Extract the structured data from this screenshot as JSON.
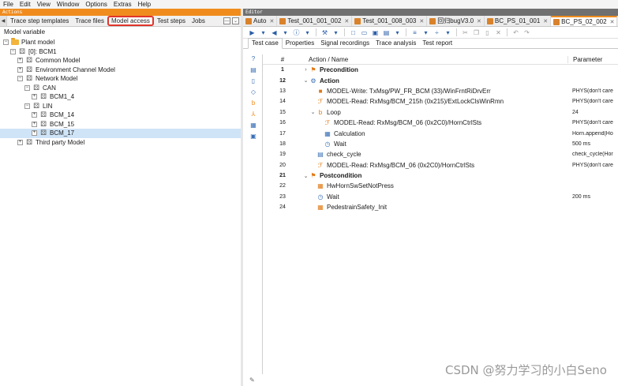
{
  "menu": [
    "File",
    "Edit",
    "View",
    "Window",
    "Options",
    "Extras",
    "Help"
  ],
  "left_panel": {
    "title": "Actions",
    "tabs": [
      "Trace step templates",
      "Trace files",
      "Model access",
      "Test steps",
      "Jobs"
    ],
    "active_tab": "Model access",
    "section_label": "Model variable",
    "tree": [
      {
        "label": "Plant model",
        "indent": 0,
        "expander": "−",
        "icon": "folder-icon"
      },
      {
        "label": "[0]: BCM1",
        "indent": 1,
        "expander": "−",
        "icon": "model-icon"
      },
      {
        "label": "Common Model",
        "indent": 2,
        "expander": "+",
        "icon": "model-icon"
      },
      {
        "label": "Environment Channel Model",
        "indent": 2,
        "expander": "+",
        "icon": "model-icon"
      },
      {
        "label": "Network Model",
        "indent": 2,
        "expander": "−",
        "icon": "model-icon"
      },
      {
        "label": "CAN",
        "indent": 3,
        "expander": "−",
        "icon": "model-icon"
      },
      {
        "label": "BCM1_4",
        "indent": 4,
        "expander": "+",
        "icon": "model-icon"
      },
      {
        "label": "LIN",
        "indent": 3,
        "expander": "−",
        "icon": "model-icon"
      },
      {
        "label": "BCM_14",
        "indent": 4,
        "expander": "+",
        "icon": "model-icon"
      },
      {
        "label": "BCM_15",
        "indent": 4,
        "expander": "+",
        "icon": "model-icon"
      },
      {
        "label": "BCM_17",
        "indent": 4,
        "expander": "+",
        "icon": "model-icon",
        "selected": true
      },
      {
        "label": "Third party Model",
        "indent": 2,
        "expander": "+",
        "icon": "model-icon"
      }
    ]
  },
  "editor": {
    "title": "Editor",
    "tabs": [
      {
        "label": "Auto",
        "active": false
      },
      {
        "label": "Test_001_001_002",
        "active": false
      },
      {
        "label": "Test_001_008_003",
        "active": false
      },
      {
        "label": "回归bugV3.0",
        "active": false
      },
      {
        "label": "BC_PS_01_001",
        "active": false
      },
      {
        "label": "BC_PS_02_002",
        "active": true
      }
    ],
    "sub_tabs": [
      "Test case",
      "Properties",
      "Signal recordings",
      "Trace analysis",
      "Test report"
    ],
    "active_sub_tab": "Test case",
    "columns": {
      "num": "#",
      "action": "Action / Name",
      "param": "Parameter"
    },
    "rows": [
      {
        "num": "1",
        "caret": "›",
        "indent": 0,
        "icon": "precondition-icon",
        "glyph": "⚑",
        "cls": "ri-orange",
        "name": "Precondition",
        "bold": true,
        "param": ""
      },
      {
        "num": "12",
        "caret": "⌄",
        "indent": 0,
        "icon": "action-icon",
        "glyph": "⚙",
        "cls": "ri-blue",
        "name": "Action",
        "bold": true,
        "param": ""
      },
      {
        "num": "13",
        "caret": "",
        "indent": 1,
        "icon": "model-write-icon",
        "glyph": "■",
        "cls": "ri-orange",
        "name": "MODEL-Write: TxMsg/PW_FR_BCM (33)/WinFrntRiDrvErr",
        "bold": false,
        "param": "PHYS(don't care"
      },
      {
        "num": "14",
        "caret": "",
        "indent": 1,
        "icon": "model-read-icon",
        "glyph": "ℱ",
        "cls": "ri-orange",
        "name": "MODEL-Read: RxMsg/BCM_215h (0x215)/ExtLockClsWinRmn",
        "bold": false,
        "param": "PHYS(don't care"
      },
      {
        "num": "15",
        "caret": "⌄",
        "indent": 1,
        "icon": "loop-icon",
        "glyph": "b",
        "cls": "ri-orange",
        "name": "Loop",
        "bold": false,
        "param": "24"
      },
      {
        "num": "16",
        "caret": "",
        "indent": 2,
        "icon": "model-read-icon",
        "glyph": "ℱ",
        "cls": "ri-orange",
        "name": "MODEL-Read: RxMsg/BCM_06 (0x2C0)/HornCtrlSts",
        "bold": false,
        "param": "PHYS(don't care"
      },
      {
        "num": "17",
        "caret": "",
        "indent": 2,
        "icon": "calculation-icon",
        "glyph": "▦",
        "cls": "ri-blue",
        "name": "Calculation",
        "bold": false,
        "param": "Horn.append(Ho"
      },
      {
        "num": "18",
        "caret": "",
        "indent": 2,
        "icon": "wait-icon",
        "glyph": "◷",
        "cls": "ri-blue",
        "name": "Wait",
        "bold": false,
        "param": "500 ms"
      },
      {
        "num": "19",
        "caret": "",
        "indent": 1,
        "icon": "check-icon",
        "glyph": "▤",
        "cls": "ri-blue",
        "name": "check_cycle",
        "bold": false,
        "param": "check_cycle(Hor"
      },
      {
        "num": "20",
        "caret": "",
        "indent": 1,
        "icon": "model-read-icon",
        "glyph": "ℱ",
        "cls": "ri-orange",
        "name": "MODEL-Read: RxMsg/BCM_06 (0x2C0)/HornCtrlSts",
        "bold": false,
        "param": "PHYS(don't care"
      },
      {
        "num": "21",
        "caret": "⌄",
        "indent": 0,
        "icon": "postcondition-icon",
        "glyph": "⚑",
        "cls": "ri-orange",
        "name": "Postcondition",
        "bold": true,
        "param": ""
      },
      {
        "num": "22",
        "caret": "",
        "indent": 1,
        "icon": "block-icon",
        "glyph": "▦",
        "cls": "ri-orange",
        "name": "HwHornSwSetNotPress",
        "bold": false,
        "param": ""
      },
      {
        "num": "23",
        "caret": "",
        "indent": 1,
        "icon": "wait-icon",
        "glyph": "◷",
        "cls": "ri-blue",
        "name": "Wait",
        "bold": false,
        "param": "200 ms"
      },
      {
        "num": "24",
        "caret": "",
        "indent": 1,
        "icon": "block-icon",
        "glyph": "▦",
        "cls": "ri-orange",
        "name": "PedestrainSafety_Init",
        "bold": false,
        "param": ""
      }
    ]
  },
  "watermark": "CSDN @努力学习的小白Seno"
}
